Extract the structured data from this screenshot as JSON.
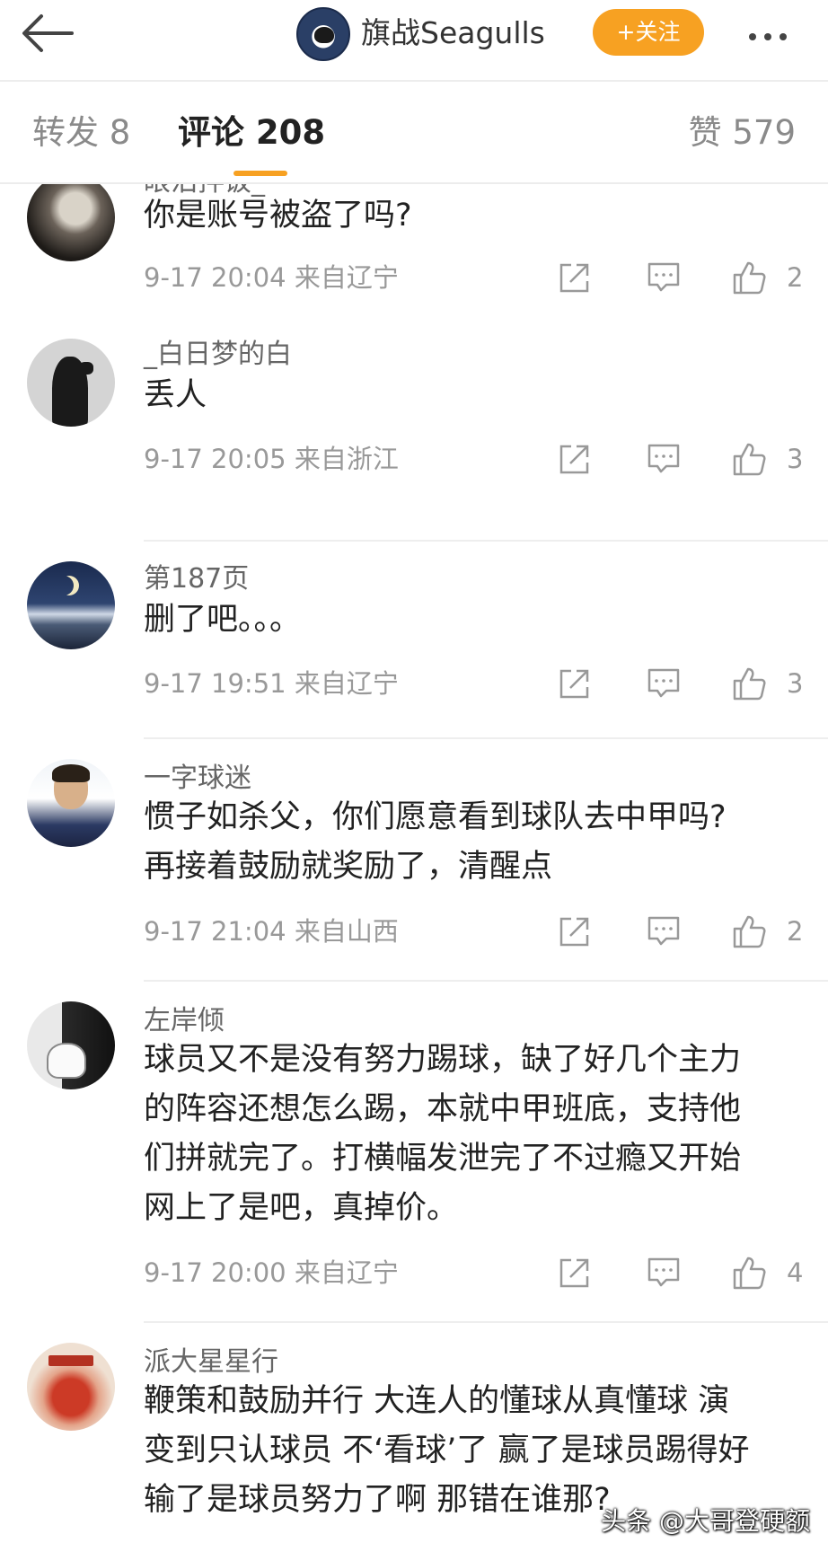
{
  "header": {
    "title": "旗战Seagulls",
    "follow_label": "+关注"
  },
  "tabs": {
    "forward": "转发 8",
    "comments": "评论 208",
    "likes": "赞 579"
  },
  "comments": [
    {
      "username": "眼泪拌饭_",
      "lines": [
        "你是账号被盗了吗?"
      ],
      "meta": "9-17 20:04  来自辽宁",
      "likes": "2"
    },
    {
      "username": "_白日梦的白",
      "lines": [
        "丢人"
      ],
      "meta": "9-17 20:05  来自浙江",
      "likes": "3"
    },
    {
      "username": "第187页",
      "lines": [
        "删了吧。。。"
      ],
      "meta": "9-17 19:51  来自辽宁",
      "likes": "3"
    },
    {
      "username": "一字球迷",
      "lines": [
        "惯子如杀父，你们愿意看到球队去中甲吗?",
        "再接着鼓励就奖励了，清醒点"
      ],
      "meta": "9-17 21:04  来自山西",
      "likes": "2"
    },
    {
      "username": "左岸倾",
      "lines": [
        "球员又不是没有努力踢球，缺了好几个主力",
        "的阵容还想怎么踢，本就中甲班底，支持他",
        "们拼就完了。打横幅发泄完了不过瘾又开始",
        "网上了是吧，真掉价。"
      ],
      "meta": "9-17 20:00  来自辽宁",
      "likes": "4"
    },
    {
      "username": "派大星星行",
      "lines": [
        "鞭策和鼓励并行 大连人的懂球从真懂球 演",
        "变到只认球员 不‘看球’了 赢了是球员踢得好",
        "输了是球员努力了啊 那错在谁那?"
      ],
      "meta": "",
      "likes": ""
    }
  ],
  "watermark": "头条 @大哥登硬额",
  "colors": {
    "accent": "#f7a122",
    "text": "#222222",
    "muted": "#999999"
  }
}
